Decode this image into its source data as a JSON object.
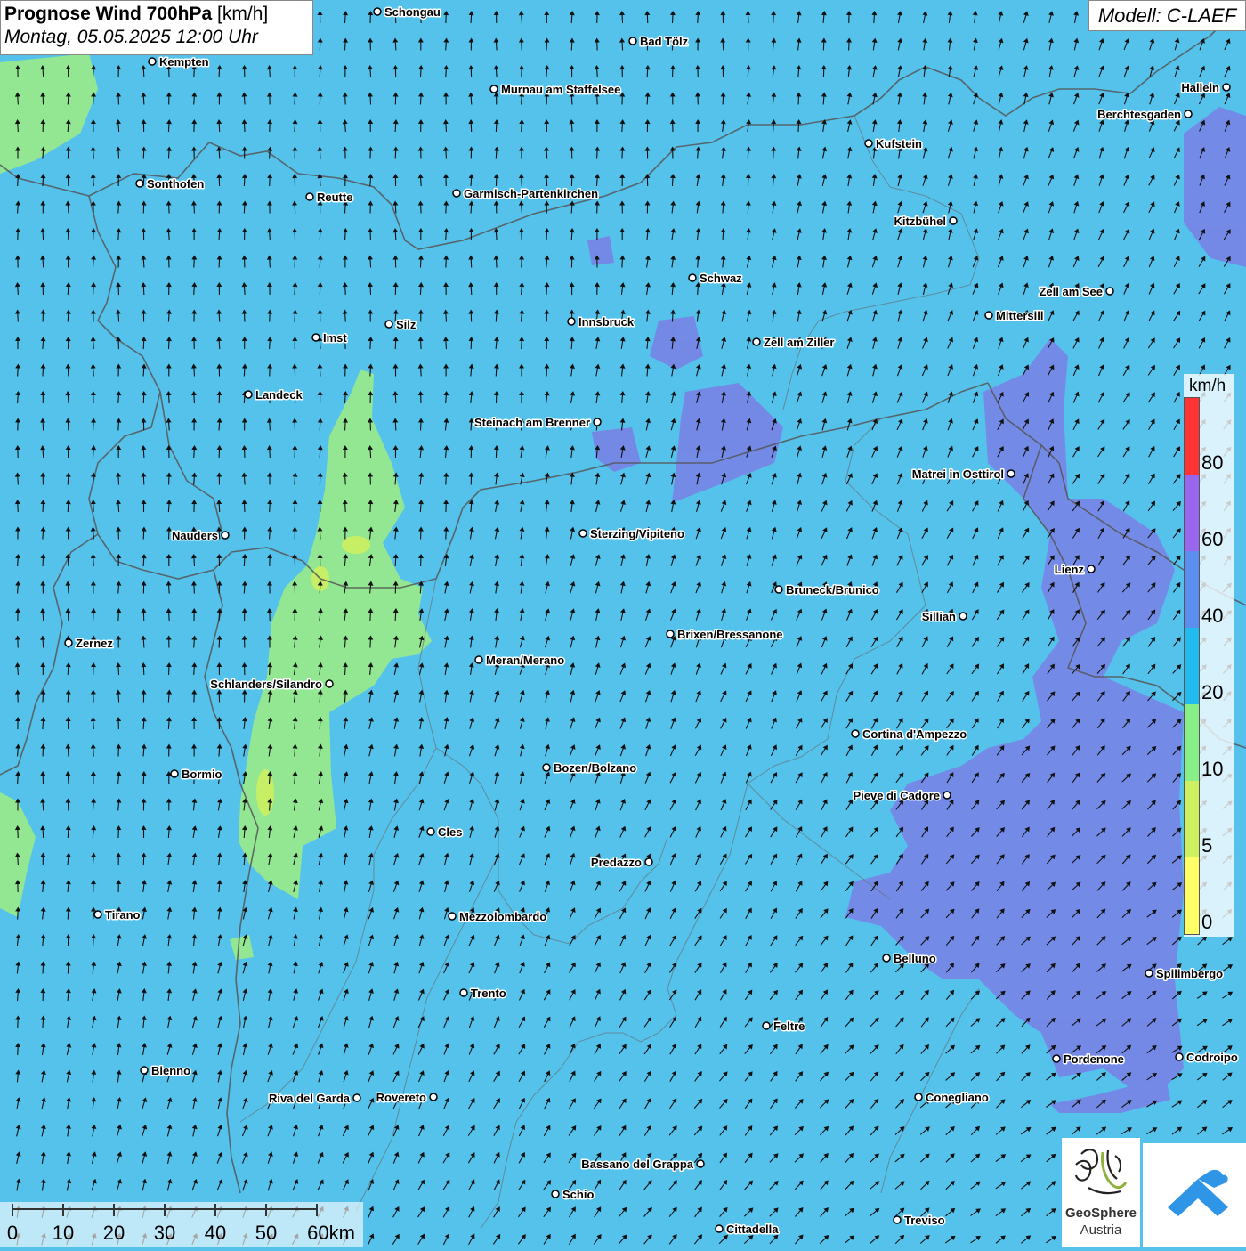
{
  "header": {
    "title_bold": "Prognose Wind 700hPa",
    "title_unit": "[km/h]",
    "datetime": "Montag, 05.05.2025 12:00 Uhr"
  },
  "model": "Modell: C-LAEF",
  "legend": {
    "unit": "km/h",
    "labels": [
      "80",
      "60",
      "40",
      "20",
      "10",
      "5",
      "0"
    ],
    "colors": [
      "#ff3333",
      "#9966ee",
      "#5c8ef0",
      "#22bbee",
      "#88ee88",
      "#ccf060",
      "#ffff66"
    ]
  },
  "map_colors": {
    "base": "#55c2ec",
    "slow": "#9aeb8a",
    "fast": "#7a80e6"
  },
  "cities": [
    {
      "name": "Schongau"
    },
    {
      "name": "Bad Tölz"
    },
    {
      "name": "Kempten"
    },
    {
      "name": "Murnau am Staffelsee"
    },
    {
      "name": "Hallein"
    },
    {
      "name": "Berchtesgaden"
    },
    {
      "name": "Kufstein"
    },
    {
      "name": "Sonthofen"
    },
    {
      "name": "Reutte"
    },
    {
      "name": "Garmisch-Partenkirchen"
    },
    {
      "name": "Kitzbühel"
    },
    {
      "name": "Schwaz"
    },
    {
      "name": "Zell am See"
    },
    {
      "name": "Innsbruck"
    },
    {
      "name": "Mittersill"
    },
    {
      "name": "Silz"
    },
    {
      "name": "Imst"
    },
    {
      "name": "Zell am Ziller"
    },
    {
      "name": "Landeck"
    },
    {
      "name": "Steinach am Brenner"
    },
    {
      "name": "Matrei in Osttirol"
    },
    {
      "name": "Nauders"
    },
    {
      "name": "Sterzing/Vipiteno"
    },
    {
      "name": "Lienz"
    },
    {
      "name": "Bruneck/Brunico"
    },
    {
      "name": "Sillian"
    },
    {
      "name": "Brixen/Bressanone"
    },
    {
      "name": "Zernez"
    },
    {
      "name": "Meran/Merano"
    },
    {
      "name": "Schlanders/Silandro"
    },
    {
      "name": "Cortina d'Ampezzo"
    },
    {
      "name": "Bozen/Bolzano"
    },
    {
      "name": "Bormio"
    },
    {
      "name": "Pieve di Cadore"
    },
    {
      "name": "Cles"
    },
    {
      "name": "Predazzo"
    },
    {
      "name": "Tirano"
    },
    {
      "name": "Mezzolombardo"
    },
    {
      "name": "Belluno"
    },
    {
      "name": "Spilimbergo"
    },
    {
      "name": "Trento"
    },
    {
      "name": "Feltre"
    },
    {
      "name": "Pordenone"
    },
    {
      "name": "Codroipo"
    },
    {
      "name": "Bienno"
    },
    {
      "name": "Riva del Garda"
    },
    {
      "name": "Rovereto"
    },
    {
      "name": "Conegliano"
    },
    {
      "name": "Bassano del Grappa"
    },
    {
      "name": "Schio"
    },
    {
      "name": "Treviso"
    },
    {
      "name": "Cittadella"
    }
  ],
  "scale": {
    "labels": [
      "0",
      "10",
      "20",
      "30",
      "40",
      "50",
      "60km"
    ]
  },
  "logos": {
    "geosphere_line1": "GeoSphere",
    "geosphere_line2": "Austria",
    "app_icon": "warn-app-icon"
  }
}
